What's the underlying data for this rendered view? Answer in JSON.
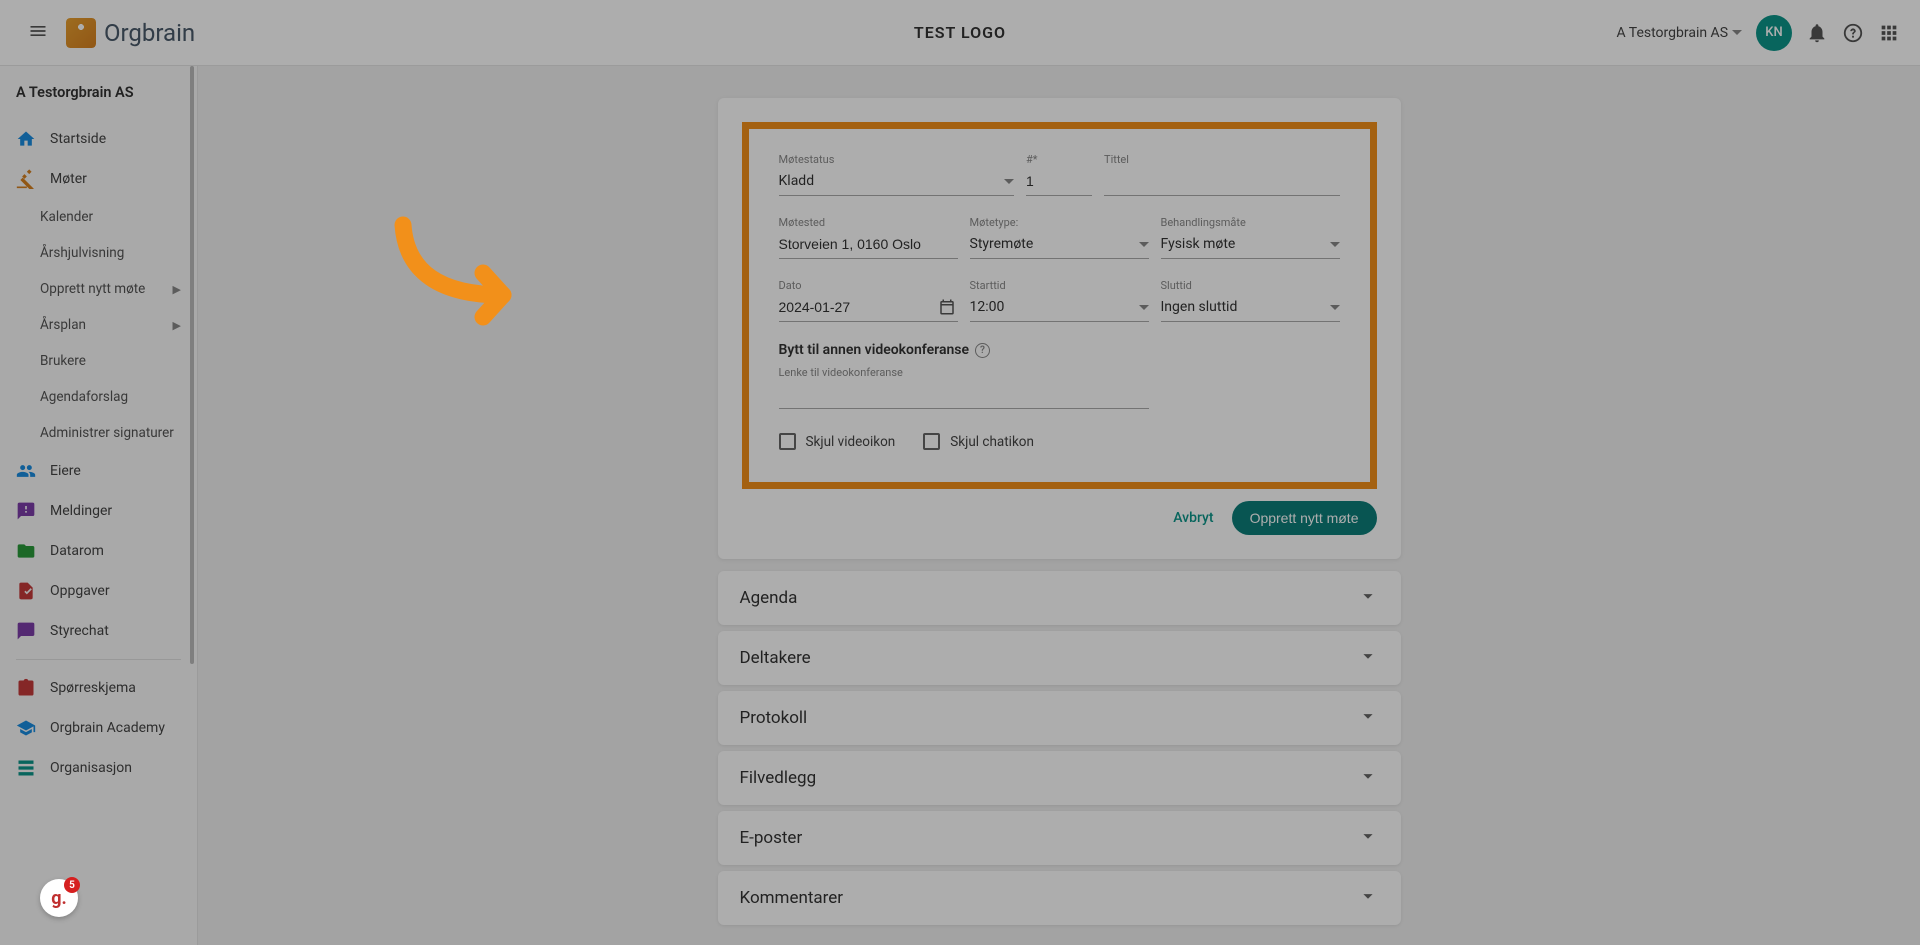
{
  "header": {
    "logo_text": "Orgbrain",
    "center_title": "TEST LOGO",
    "org_name": "A Testorgbrain AS",
    "avatar": "KN"
  },
  "sidebar": {
    "title": "A Testorgbrain AS",
    "items": {
      "startside": "Startside",
      "moter": "Møter",
      "kalender": "Kalender",
      "arshjul": "Årshjulvisning",
      "opprett": "Opprett nytt møte",
      "arsplan": "Årsplan",
      "brukere": "Brukere",
      "agendaforslag": "Agendaforslag",
      "signaturer": "Administrer signaturer",
      "eiere": "Eiere",
      "meldinger": "Meldinger",
      "datarom": "Datarom",
      "oppgaver": "Oppgaver",
      "styrechat": "Styrechat",
      "sporre": "Spørreskjema",
      "academy": "Orgbrain Academy",
      "organisasjon": "Organisasjon"
    }
  },
  "form": {
    "labels": {
      "motestatus": "Møtestatus",
      "nummer": "#*",
      "tittel": "Tittel",
      "motested": "Møtested",
      "motetype": "Møtetype:",
      "behandling": "Behandlingsmåte",
      "dato": "Dato",
      "starttid": "Starttid",
      "sluttid": "Sluttid",
      "videoconf_title": "Bytt til annen videokonferanse",
      "videoconf_link": "Lenke til videokonferanse",
      "skjul_video": "Skjul videoikon",
      "skjul_chat": "Skjul chatikon"
    },
    "values": {
      "motestatus": "Kladd",
      "nummer": "1",
      "tittel": "",
      "motested": "Storveien 1, 0160 Oslo",
      "motetype": "Styremøte",
      "behandling": "Fysisk møte",
      "dato": "2024-01-27",
      "starttid": "12:00",
      "sluttid": "Ingen sluttid",
      "videoconf_link": ""
    },
    "actions": {
      "cancel": "Avbryt",
      "submit": "Opprett nytt møte"
    }
  },
  "accordions": {
    "agenda": "Agenda",
    "deltakere": "Deltakere",
    "protokoll": "Protokoll",
    "filvedlegg": "Filvedlegg",
    "eposter": "E-poster",
    "kommentarer": "Kommentarer"
  },
  "float_badge": "5"
}
